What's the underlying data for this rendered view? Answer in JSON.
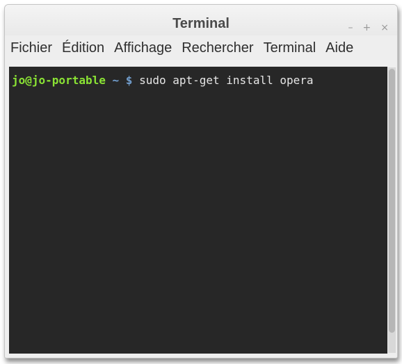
{
  "window": {
    "title": "Terminal",
    "controls": {
      "minimize": "–",
      "maximize": "+",
      "close": "×"
    }
  },
  "menu": {
    "items": [
      "Fichier",
      "Édition",
      "Affichage",
      "Rechercher",
      "Terminal",
      "Aide"
    ]
  },
  "terminal": {
    "prompt_user": "jo@jo-portable",
    "prompt_path": "~",
    "prompt_symbol": "$",
    "command": "sudo apt-get install opera"
  },
  "colors": {
    "terminal_background": "#272727",
    "prompt_user": "#8ae234",
    "prompt_path": "#729fcf",
    "text": "#e6e6e6"
  },
  "icons": {
    "minimize": "minimize-icon",
    "maximize": "maximize-icon",
    "close": "close-icon"
  }
}
